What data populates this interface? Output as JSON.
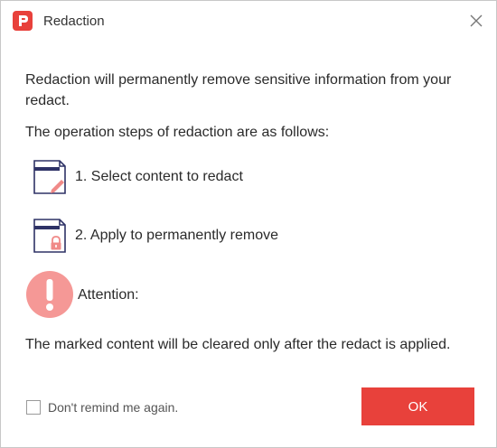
{
  "window": {
    "title": "Redaction",
    "close_icon": "close-icon",
    "logo_icon": "app-logo-icon"
  },
  "content": {
    "intro": "Redaction will permanently remove sensitive information from your redact.",
    "steps_heading": "The operation steps of redaction are as follows:",
    "steps": [
      {
        "label": "1. Select content to redact",
        "icon": "document-pencil-icon"
      },
      {
        "label": "2. Apply to permanently remove",
        "icon": "document-lock-icon"
      }
    ],
    "attention_label": "Attention:",
    "attention_icon": "exclamation-icon",
    "note": "The marked content will be cleared only after the redact is applied."
  },
  "footer": {
    "checkbox_label": "Don't remind me again.",
    "checkbox_checked": false,
    "ok_label": "OK"
  },
  "colors": {
    "accent": "#e8413b",
    "icon_navy": "#2e3266",
    "icon_pink": "#f08a88",
    "attention_circle": "#f59896"
  }
}
